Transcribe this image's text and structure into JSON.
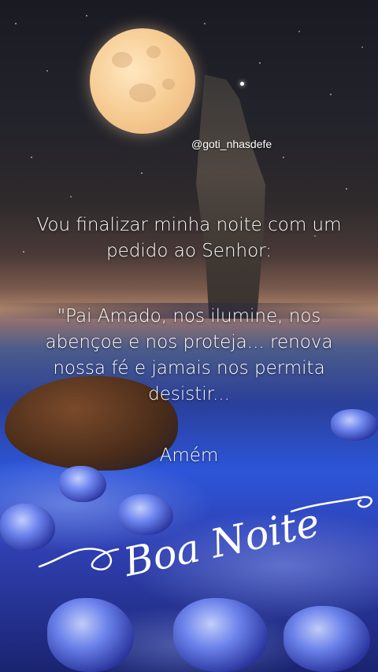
{
  "watermark": "@goti_nhasdefe",
  "message": {
    "line1": "Vou finalizar minha noite com um",
    "line2": "pedido ao Senhor:",
    "quote1": "\"Pai Amado, nos ilumine, nos",
    "quote2": "abençoe e nos proteja... renova",
    "quote3": "nossa fé e jamais nos permita",
    "quote4": "desistir...",
    "amen": "Amém"
  },
  "greeting": "Boa Noite"
}
